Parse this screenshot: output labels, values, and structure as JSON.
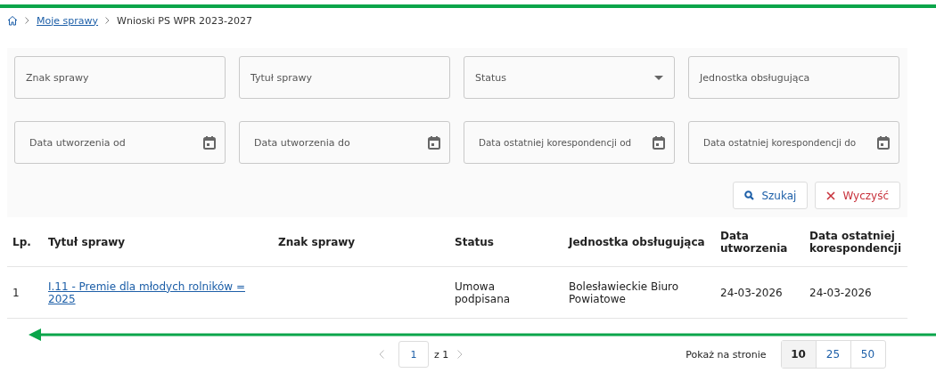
{
  "breadcrumb": {
    "items": [
      {
        "label": "Moje sprawy",
        "kind": "link"
      },
      {
        "label": "Wnioski PS WPR 2023-2027",
        "kind": "current"
      }
    ]
  },
  "filters": [
    {
      "placeholder": "Znak sprawy",
      "kind": "text"
    },
    {
      "placeholder": "Tytuł sprawy",
      "kind": "text"
    },
    {
      "placeholder": "Status",
      "kind": "select"
    },
    {
      "placeholder": "Jednostka obsługująca",
      "kind": "text"
    },
    {
      "placeholder": "Data utworzenia od",
      "kind": "date"
    },
    {
      "placeholder": "Data utworzenia do",
      "kind": "date"
    },
    {
      "placeholder": "Data ostatniej korespondencji od",
      "kind": "date"
    },
    {
      "placeholder": "Data ostatniej korespondencji do",
      "kind": "date"
    }
  ],
  "buttons": [
    {
      "label": "Szukaj",
      "kind": "search"
    },
    {
      "label": "Wyczyść",
      "kind": "clear"
    }
  ],
  "table": {
    "columns": [
      "Lp.",
      "Tytuł sprawy",
      "Znak sprawy",
      "Status",
      "Jednostka obsługująca",
      "Data utworzenia",
      "Data ostatniej korespondencji"
    ],
    "rows": [
      {
        "cells": [
          "1",
          "I.11 - Premie dla młodych rolników = 2025",
          "",
          "Umowa podpisana",
          "Bolesławieckie Biuro Powiatowe",
          "24-03-2026",
          "24-03-2026"
        ]
      }
    ]
  },
  "pagination": {
    "page": "1",
    "of": "z 1",
    "page_size_label": "Pokaż na stronie",
    "page_sizes": [
      {
        "label": "10",
        "selected": true
      },
      {
        "label": "25",
        "selected": false
      },
      {
        "label": "50",
        "selected": false
      }
    ]
  }
}
